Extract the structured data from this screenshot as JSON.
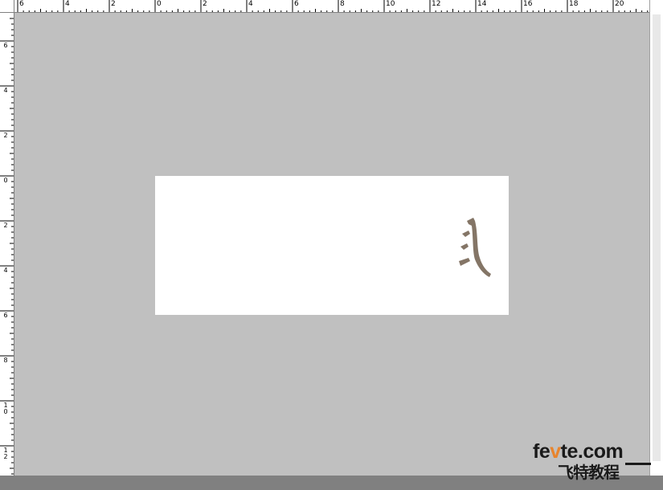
{
  "rulers": {
    "top_labels": [
      "6",
      "4",
      "2",
      "0",
      "2",
      "4",
      "6",
      "8",
      "10",
      "12",
      "14",
      "16",
      "18",
      "20"
    ],
    "left_labels": [
      "6",
      "4",
      "2",
      "0",
      "2",
      "4",
      "6",
      "8",
      "10",
      "12"
    ]
  },
  "canvas": {
    "background": "#c0c0c0",
    "document_background": "#ffffff",
    "glyph_color": "#847566"
  },
  "watermark": {
    "prefix": "fe",
    "accent": "v",
    "suffix": "te.com",
    "subtitle": "飞特教程"
  },
  "colors": {
    "watermark_accent": "#e8842c",
    "ruler_background": "#ffffff",
    "bottom_bar": "#808080"
  }
}
